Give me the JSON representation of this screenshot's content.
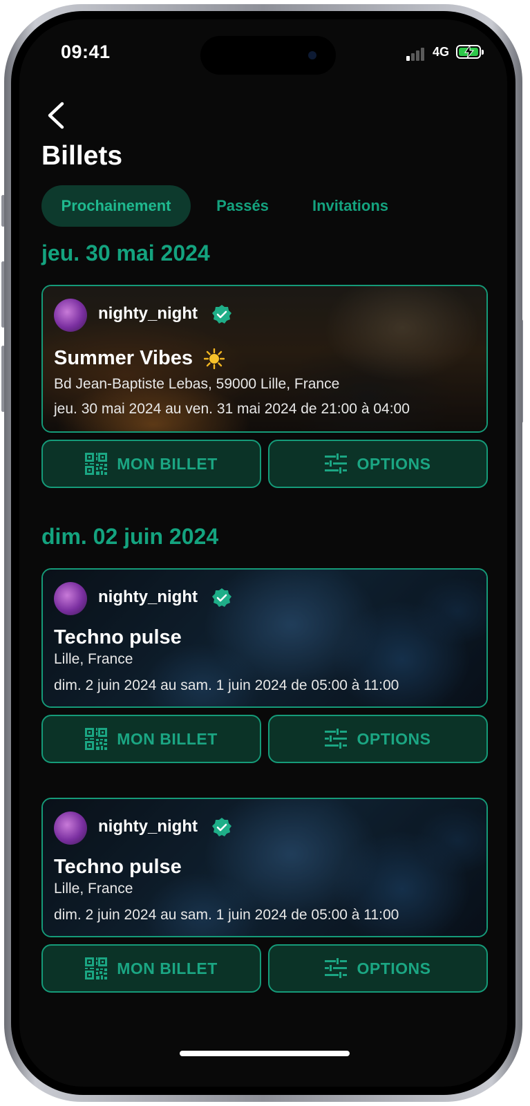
{
  "status_bar": {
    "time": "09:41",
    "network": "4G"
  },
  "header": {
    "title": "Billets"
  },
  "tabs": [
    {
      "label": "Prochainement",
      "active": true
    },
    {
      "label": "Passés",
      "active": false
    },
    {
      "label": "Invitations",
      "active": false
    }
  ],
  "groups": [
    {
      "date": "jeu. 30 mai 2024",
      "tickets": [
        {
          "host": "nighty_night",
          "title": "Summer Vibes",
          "address": "Bd Jean-Baptiste Lebas, 59000 Lille, France",
          "when": "jeu. 30 mai 2024 au ven. 31 mai 2024 de 21:00 à 04:00",
          "ticket_label": "MON BILLET",
          "options_label": "OPTIONS"
        }
      ]
    },
    {
      "date": "dim. 02 juin 2024",
      "tickets": [
        {
          "host": "nighty_night",
          "title": "Techno pulse",
          "address": "Lille, France",
          "when": "dim. 2 juin 2024 au sam. 1 juin 2024 de 05:00 à 11:00",
          "ticket_label": "MON BILLET",
          "options_label": "OPTIONS"
        },
        {
          "host": "nighty_night",
          "title": "Techno pulse",
          "address": "Lille, France",
          "when": "dim. 2 juin 2024 au sam. 1 juin 2024 de 05:00 à 11:00",
          "ticket_label": "MON BILLET",
          "options_label": "OPTIONS"
        }
      ]
    }
  ],
  "colors": {
    "accent": "#14a37f",
    "button_bg": "#0b3327",
    "screen_bg": "#090909"
  }
}
